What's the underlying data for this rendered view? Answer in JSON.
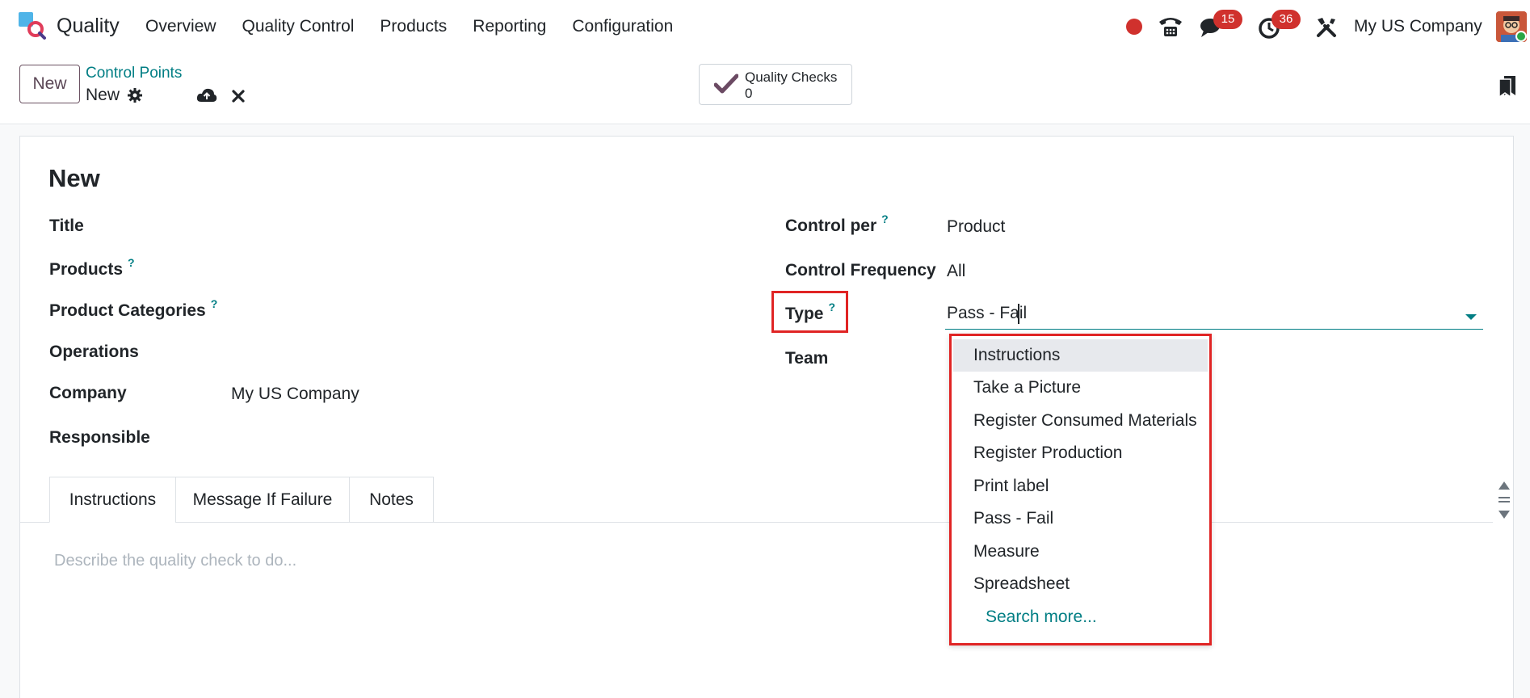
{
  "navbar": {
    "app_name": "Quality",
    "menu": [
      "Overview",
      "Quality Control",
      "Products",
      "Reporting",
      "Configuration"
    ],
    "messages_count": "15",
    "activities_count": "36",
    "company": "My US Company"
  },
  "control_panel": {
    "new_label": "New",
    "breadcrumb_parent": "Control Points",
    "breadcrumb_current": "New",
    "smart_button_label": "Quality Checks",
    "smart_button_value": "0"
  },
  "form": {
    "record_title": "New",
    "left_fields": {
      "title": "Title",
      "products": "Products",
      "product_categories": "Product Categories",
      "operations": "Operations",
      "company": "Company",
      "company_value": "My US Company",
      "responsible": "Responsible"
    },
    "right_fields": {
      "control_per": "Control per",
      "control_per_value": "Product",
      "control_frequency": "Control Frequency",
      "control_frequency_value": "All",
      "type": "Type",
      "type_value": "Pass - Fail",
      "team": "Team"
    },
    "help_mark": "?"
  },
  "dropdown": {
    "options": [
      "Instructions",
      "Take a Picture",
      "Register Consumed Materials",
      "Register Production",
      "Print label",
      "Pass - Fail",
      "Measure",
      "Spreadsheet"
    ],
    "search_more": "Search more..."
  },
  "tabs": {
    "items": [
      "Instructions",
      "Message If Failure",
      "Notes"
    ],
    "placeholder": "Describe the quality check to do..."
  },
  "colors": {
    "accent": "#017e84",
    "highlight": "#e02424",
    "badge": "#d0312d"
  }
}
